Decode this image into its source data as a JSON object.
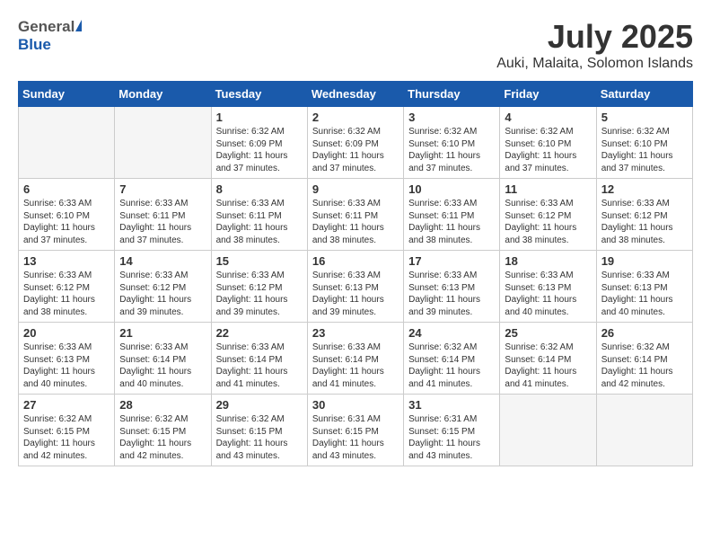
{
  "logo": {
    "general": "General",
    "blue": "Blue"
  },
  "header": {
    "month": "July 2025",
    "location": "Auki, Malaita, Solomon Islands"
  },
  "weekdays": [
    "Sunday",
    "Monday",
    "Tuesday",
    "Wednesday",
    "Thursday",
    "Friday",
    "Saturday"
  ],
  "weeks": [
    [
      {
        "day": "",
        "info": ""
      },
      {
        "day": "",
        "info": ""
      },
      {
        "day": "1",
        "info": "Sunrise: 6:32 AM\nSunset: 6:09 PM\nDaylight: 11 hours and 37 minutes."
      },
      {
        "day": "2",
        "info": "Sunrise: 6:32 AM\nSunset: 6:09 PM\nDaylight: 11 hours and 37 minutes."
      },
      {
        "day": "3",
        "info": "Sunrise: 6:32 AM\nSunset: 6:10 PM\nDaylight: 11 hours and 37 minutes."
      },
      {
        "day": "4",
        "info": "Sunrise: 6:32 AM\nSunset: 6:10 PM\nDaylight: 11 hours and 37 minutes."
      },
      {
        "day": "5",
        "info": "Sunrise: 6:32 AM\nSunset: 6:10 PM\nDaylight: 11 hours and 37 minutes."
      }
    ],
    [
      {
        "day": "6",
        "info": "Sunrise: 6:33 AM\nSunset: 6:10 PM\nDaylight: 11 hours and 37 minutes."
      },
      {
        "day": "7",
        "info": "Sunrise: 6:33 AM\nSunset: 6:11 PM\nDaylight: 11 hours and 37 minutes."
      },
      {
        "day": "8",
        "info": "Sunrise: 6:33 AM\nSunset: 6:11 PM\nDaylight: 11 hours and 38 minutes."
      },
      {
        "day": "9",
        "info": "Sunrise: 6:33 AM\nSunset: 6:11 PM\nDaylight: 11 hours and 38 minutes."
      },
      {
        "day": "10",
        "info": "Sunrise: 6:33 AM\nSunset: 6:11 PM\nDaylight: 11 hours and 38 minutes."
      },
      {
        "day": "11",
        "info": "Sunrise: 6:33 AM\nSunset: 6:12 PM\nDaylight: 11 hours and 38 minutes."
      },
      {
        "day": "12",
        "info": "Sunrise: 6:33 AM\nSunset: 6:12 PM\nDaylight: 11 hours and 38 minutes."
      }
    ],
    [
      {
        "day": "13",
        "info": "Sunrise: 6:33 AM\nSunset: 6:12 PM\nDaylight: 11 hours and 38 minutes."
      },
      {
        "day": "14",
        "info": "Sunrise: 6:33 AM\nSunset: 6:12 PM\nDaylight: 11 hours and 39 minutes."
      },
      {
        "day": "15",
        "info": "Sunrise: 6:33 AM\nSunset: 6:12 PM\nDaylight: 11 hours and 39 minutes."
      },
      {
        "day": "16",
        "info": "Sunrise: 6:33 AM\nSunset: 6:13 PM\nDaylight: 11 hours and 39 minutes."
      },
      {
        "day": "17",
        "info": "Sunrise: 6:33 AM\nSunset: 6:13 PM\nDaylight: 11 hours and 39 minutes."
      },
      {
        "day": "18",
        "info": "Sunrise: 6:33 AM\nSunset: 6:13 PM\nDaylight: 11 hours and 40 minutes."
      },
      {
        "day": "19",
        "info": "Sunrise: 6:33 AM\nSunset: 6:13 PM\nDaylight: 11 hours and 40 minutes."
      }
    ],
    [
      {
        "day": "20",
        "info": "Sunrise: 6:33 AM\nSunset: 6:13 PM\nDaylight: 11 hours and 40 minutes."
      },
      {
        "day": "21",
        "info": "Sunrise: 6:33 AM\nSunset: 6:14 PM\nDaylight: 11 hours and 40 minutes."
      },
      {
        "day": "22",
        "info": "Sunrise: 6:33 AM\nSunset: 6:14 PM\nDaylight: 11 hours and 41 minutes."
      },
      {
        "day": "23",
        "info": "Sunrise: 6:33 AM\nSunset: 6:14 PM\nDaylight: 11 hours and 41 minutes."
      },
      {
        "day": "24",
        "info": "Sunrise: 6:32 AM\nSunset: 6:14 PM\nDaylight: 11 hours and 41 minutes."
      },
      {
        "day": "25",
        "info": "Sunrise: 6:32 AM\nSunset: 6:14 PM\nDaylight: 11 hours and 41 minutes."
      },
      {
        "day": "26",
        "info": "Sunrise: 6:32 AM\nSunset: 6:14 PM\nDaylight: 11 hours and 42 minutes."
      }
    ],
    [
      {
        "day": "27",
        "info": "Sunrise: 6:32 AM\nSunset: 6:15 PM\nDaylight: 11 hours and 42 minutes."
      },
      {
        "day": "28",
        "info": "Sunrise: 6:32 AM\nSunset: 6:15 PM\nDaylight: 11 hours and 42 minutes."
      },
      {
        "day": "29",
        "info": "Sunrise: 6:32 AM\nSunset: 6:15 PM\nDaylight: 11 hours and 43 minutes."
      },
      {
        "day": "30",
        "info": "Sunrise: 6:31 AM\nSunset: 6:15 PM\nDaylight: 11 hours and 43 minutes."
      },
      {
        "day": "31",
        "info": "Sunrise: 6:31 AM\nSunset: 6:15 PM\nDaylight: 11 hours and 43 minutes."
      },
      {
        "day": "",
        "info": ""
      },
      {
        "day": "",
        "info": ""
      }
    ]
  ]
}
